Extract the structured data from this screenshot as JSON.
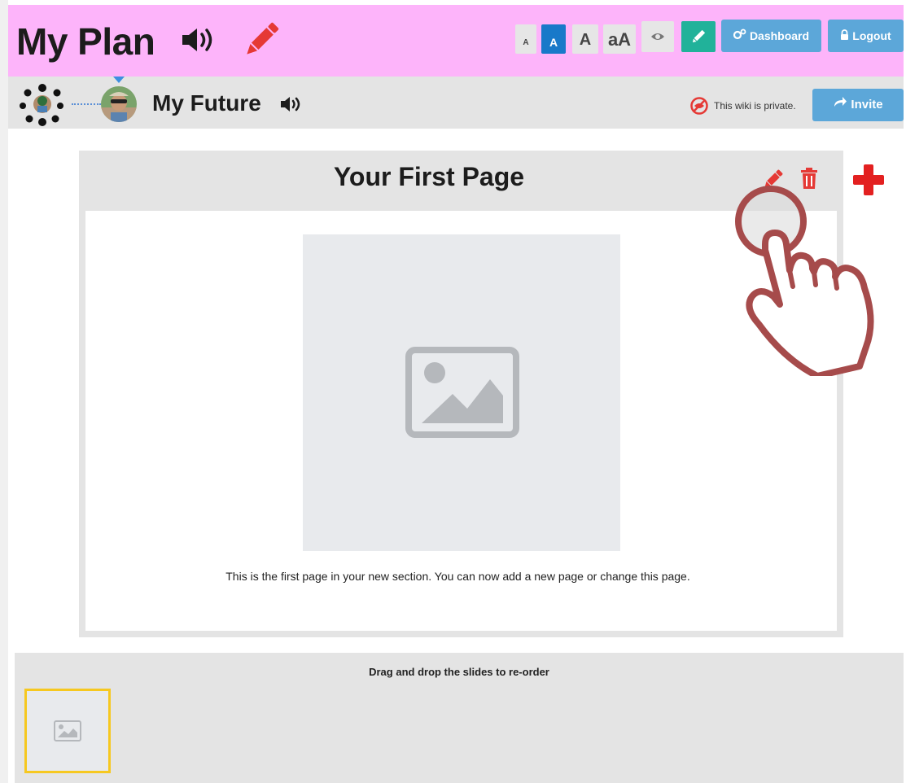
{
  "header": {
    "app_title": "My Plan",
    "font_size_buttons": [
      "A",
      "A",
      "A",
      "aA"
    ],
    "dashboard_label": "Dashboard",
    "logout_label": "Logout"
  },
  "subheader": {
    "section_title": "My Future",
    "privacy_text": "This wiki is private.",
    "invite_label": "Invite"
  },
  "page": {
    "title": "Your First Page",
    "body_text": "This is the first page in your new section. You can now add a new page or change this page."
  },
  "slides": {
    "instruction": "Drag and drop the slides to re-order"
  },
  "colors": {
    "header_bg": "#fdb4fa",
    "button_blue": "#5ca7d9",
    "edit_green": "#21b29a",
    "accent_red": "#e53935",
    "hand_outline": "#a64b4b",
    "selected_slide": "#f6c820"
  },
  "icons": [
    "speaker-icon",
    "pencil-icon",
    "eye-icon",
    "cogs-icon",
    "lock-icon",
    "network-icon",
    "privacy-icon",
    "share-icon",
    "trash-icon",
    "plus-icon",
    "image-icon",
    "hand-pointer-icon"
  ]
}
